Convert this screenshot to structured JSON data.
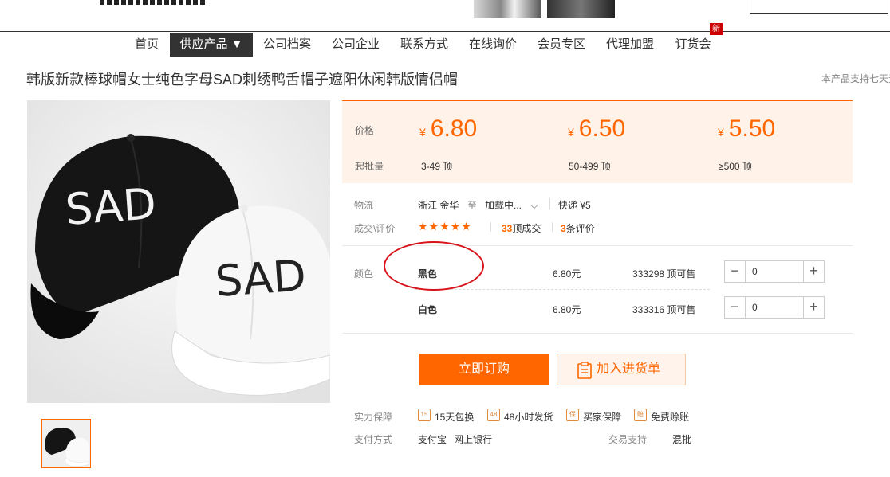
{
  "nav": {
    "items": [
      "首页",
      "供应产品 ▼",
      "公司档案",
      "公司企业",
      "联系方式",
      "在线询价",
      "会员专区",
      "代理加盟",
      "订货会"
    ],
    "badge": "新"
  },
  "product": {
    "title": "韩版新款棒球帽女士纯色字母SAD刺绣鸭舌帽子遮阳休闲韩版情侣帽",
    "support": "本产品支持七天无",
    "image_text": "SAD"
  },
  "price_box": {
    "price_label": "价格",
    "moq_label": "起批量",
    "currency": "¥",
    "tiers": [
      {
        "price": "6.80",
        "range": "3-49",
        "unit": "顶"
      },
      {
        "price": "6.50",
        "range": "50-499",
        "unit": "顶"
      },
      {
        "price": "5.50",
        "range": "≥500",
        "unit": "顶"
      }
    ]
  },
  "logistics": {
    "label": "物流",
    "from": "浙江 金华",
    "to_word": "至",
    "dest": "加载中...",
    "express": "快递 ¥5"
  },
  "deal": {
    "label": "成交\\评价",
    "stars": "★★★★★",
    "rating": 5,
    "sold_count": "33",
    "sold_suffix": "顶成交",
    "review_count": "3",
    "review_suffix": "条评价"
  },
  "colors": {
    "label": "颜色",
    "options": [
      {
        "name": "黑色",
        "price": "6.80元",
        "stock": "333298 顶可售",
        "qty": "0"
      },
      {
        "name": "白色",
        "price": "6.80元",
        "stock": "333316 顶可售",
        "qty": "0"
      }
    ]
  },
  "actions": {
    "buy": "立即订购",
    "cart": "加入进货单"
  },
  "guarantee": {
    "label": "实力保障",
    "items": [
      {
        "icon": "15-days-icon",
        "glyph": "15",
        "text": "15天包换"
      },
      {
        "icon": "48-hours-icon",
        "glyph": "48",
        "text": "48小时发货"
      },
      {
        "icon": "shield-icon",
        "glyph": "保",
        "text": "买家保障"
      },
      {
        "icon": "compensation-icon",
        "glyph": "赔",
        "text": "免费赊账"
      }
    ]
  },
  "payment": {
    "label": "支付方式",
    "methods": [
      "支付宝",
      "网上银行"
    ],
    "trade_label": "交易支持",
    "trade_value": "混批"
  },
  "colors_theme": {
    "accent": "#ff6600",
    "price_bg": "#fff2e8",
    "annotation": "#d8131b"
  }
}
